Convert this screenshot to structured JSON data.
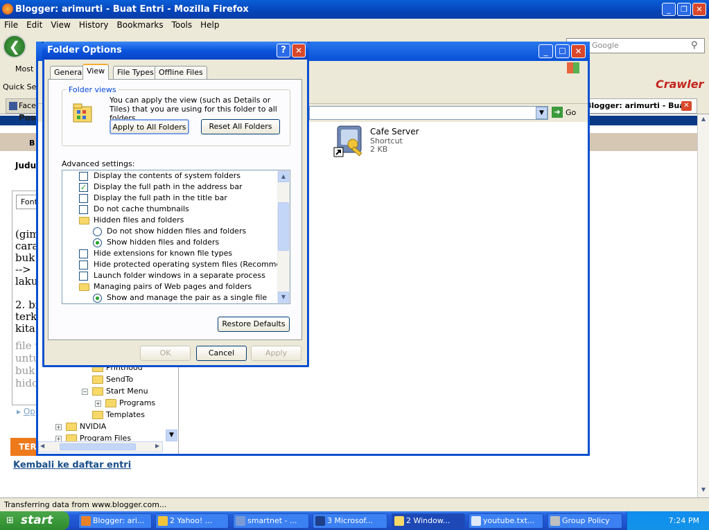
{
  "firefox": {
    "title": "Blogger: arimurti - Buat Entri - Mozilla Firefox",
    "menu": [
      "File",
      "Edit",
      "View",
      "History",
      "Bookmarks",
      "Tools",
      "Help"
    ],
    "search_placeholder": "Google",
    "bookmarks_label": "Most V",
    "toolbar_label": "Quick Sea",
    "toolbar_brand": "Crawler",
    "tab_left_label": "Face",
    "tab_active_label": "Blogger: arimurti - Buat ...",
    "status_text": "Transferring data from www.blogger.com..."
  },
  "blogger": {
    "post_label": "Pos",
    "tab_b": "B",
    "judul_label": "Judul",
    "font_label": "Font",
    "editor_text": "(gim\ncara\nbuk\n-->\nlaku\n\n2. bi\nterk\nkita",
    "editor_grey": "file v\nuntu\nbuk\nhido",
    "opt_label": "Op",
    "terbit_label": "TER",
    "kembali_label": "Kembali ke daftar entri"
  },
  "explorer": {
    "address_go": "Go",
    "file_name": "Cafe Server",
    "file_type": "Shortcut",
    "file_size": "2 KB",
    "tree": [
      {
        "label": "Printhood",
        "pm": "",
        "indent": 2
      },
      {
        "label": "SendTo",
        "pm": "",
        "indent": 2
      },
      {
        "label": "Start Menu",
        "pm": "−",
        "indent": 2
      },
      {
        "label": "Programs",
        "pm": "+",
        "indent": 3
      },
      {
        "label": "Templates",
        "pm": "",
        "indent": 2
      },
      {
        "label": "NVIDIA",
        "pm": "+",
        "indent": 0
      },
      {
        "label": "Program Files",
        "pm": "+",
        "indent": 0
      }
    ]
  },
  "dialog": {
    "title": "Folder Options",
    "help": "?",
    "close": "✕",
    "tabs": [
      "General",
      "View",
      "File Types",
      "Offline Files"
    ],
    "active_tab": "View",
    "folder_views": {
      "legend": "Folder views",
      "text": "You can apply the view (such as Details or Tiles) that you are using for this folder to all folders.",
      "apply_all": "Apply to All Folders",
      "reset_all": "Reset All Folders"
    },
    "advanced_label": "Advanced settings:",
    "advanced_items": [
      {
        "type": "checkbox",
        "label": "Display the contents of system folders",
        "checked": false,
        "indent": 0
      },
      {
        "type": "checkbox",
        "label": "Display the full path in the address bar",
        "checked": true,
        "indent": 0
      },
      {
        "type": "checkbox",
        "label": "Display the full path in the title bar",
        "checked": false,
        "indent": 0
      },
      {
        "type": "checkbox",
        "label": "Do not cache thumbnails",
        "checked": false,
        "indent": 0
      },
      {
        "type": "folder",
        "label": "Hidden files and folders",
        "indent": 0
      },
      {
        "type": "radio",
        "label": "Do not show hidden files and folders",
        "checked": false,
        "indent": 1
      },
      {
        "type": "radio",
        "label": "Show hidden files and folders",
        "checked": true,
        "indent": 1
      },
      {
        "type": "checkbox",
        "label": "Hide extensions for known file types",
        "checked": false,
        "indent": 0
      },
      {
        "type": "checkbox",
        "label": "Hide protected operating system files (Recommended)",
        "checked": false,
        "indent": 0
      },
      {
        "type": "checkbox",
        "label": "Launch folder windows in a separate process",
        "checked": false,
        "indent": 0
      },
      {
        "type": "folder",
        "label": "Managing pairs of Web pages and folders",
        "indent": 0
      },
      {
        "type": "radio",
        "label": "Show and manage the pair as a single file",
        "checked": true,
        "indent": 1
      }
    ],
    "restore_defaults": "Restore Defaults",
    "ok": "OK",
    "cancel": "Cancel",
    "apply": "Apply"
  },
  "taskbar": {
    "start": "start",
    "tasks": [
      {
        "label": "Blogger: ari...",
        "color": "#e8822a",
        "active": false
      },
      {
        "label": "2 Yahoo! ...",
        "color": "#f2c43b",
        "active": false
      },
      {
        "label": "smartnet - ...",
        "color": "#7a9ad6",
        "active": false
      },
      {
        "label": "3 Microsof...",
        "color": "#1e3f8a",
        "active": false
      },
      {
        "label": "2 Window...",
        "color": "#f7d868",
        "active": true
      },
      {
        "label": "youtube.txt...",
        "color": "#dfe8f7",
        "active": false
      },
      {
        "label": "Group Policy",
        "color": "#c0c0c0",
        "active": false
      }
    ],
    "clock": "7:24 PM"
  }
}
